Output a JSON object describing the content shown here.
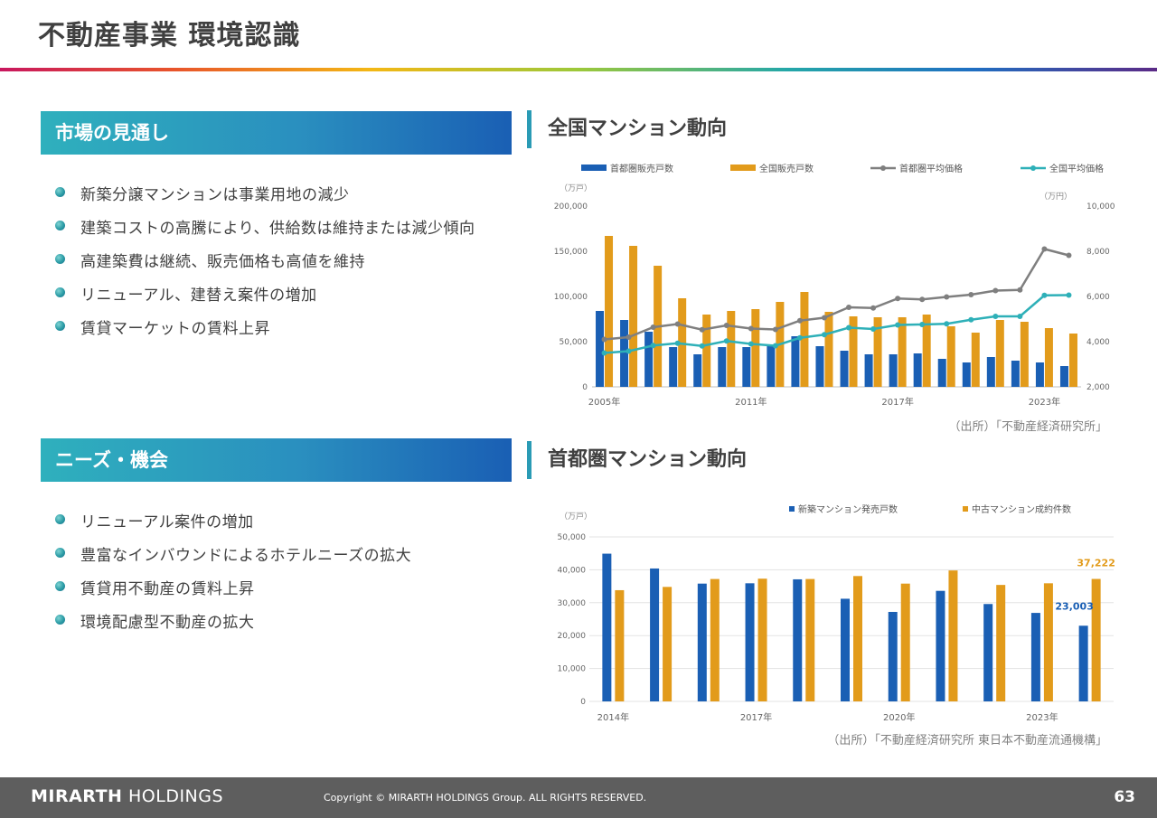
{
  "page": {
    "title": "不動産事業 環境認識",
    "page_number": "63"
  },
  "market": {
    "heading": "市場の見通し",
    "bullets": [
      "新築分譲マンションは事業用地の減少",
      "建築コストの高騰により、供給数は維持または減少傾向",
      "高建築費は継続、販売価格も高値を維持",
      "リニューアル、建替え案件の増加",
      "賃貸マーケットの賃料上昇"
    ]
  },
  "needs": {
    "heading": "ニーズ・機会",
    "bullets": [
      "リニューアル案件の増加",
      "豊富なインバウンドによるホテルニーズの拡大",
      "賃貸用不動産の賃料上昇",
      "環境配慮型不動産の拡大"
    ]
  },
  "footer": {
    "logo_bold": "MIRARTH",
    "logo_rest": "HOLDINGS",
    "copyright": "Copyright © MIRARTH HOLDINGS Group. ALL RIGHTS RESERVED."
  },
  "colors": {
    "blue": "#1a5fb4",
    "gold": "#e29b1b",
    "gray_line": "#7f7f7f",
    "teal_line": "#2eb0b8"
  },
  "chart_data": [
    {
      "type": "bar",
      "title": "全国マンション動向",
      "source": "（出所）「不動産経済研究所」",
      "y_unit": "（万戸）",
      "y2_unit": "（万円）",
      "ylim": [
        0,
        200000
      ],
      "y2lim": [
        2000,
        10000
      ],
      "y_ticks": [
        "200,000",
        "150,000",
        "100,000",
        "50,000",
        "0"
      ],
      "y2_ticks": [
        "10,000",
        "8,000",
        "6,000",
        "4,000",
        "2,000"
      ],
      "x_tick_labels": [
        {
          "index": 0,
          "label": "2005年"
        },
        {
          "index": 6,
          "label": "2011年"
        },
        {
          "index": 12,
          "label": "2017年"
        },
        {
          "index": 18,
          "label": "2023年"
        }
      ],
      "legend_position": "top",
      "categories": [
        "2005",
        "2006",
        "2007",
        "2008",
        "2009",
        "2010",
        "2011",
        "2012",
        "2013",
        "2014",
        "2015",
        "2016",
        "2017",
        "2018",
        "2019",
        "2020",
        "2021",
        "2022",
        "2023",
        "2024"
      ],
      "series": [
        {
          "name": "首都圏販売戸数",
          "kind": "bar",
          "axis": "left",
          "values": [
            84000,
            74000,
            61000,
            44000,
            36000,
            44000,
            44000,
            45000,
            56000,
            45000,
            40000,
            36000,
            36000,
            37000,
            31000,
            27000,
            33000,
            29000,
            27000,
            23000
          ]
        },
        {
          "name": "全国販売戸数",
          "kind": "bar",
          "axis": "left",
          "values": [
            167000,
            156000,
            134000,
            98000,
            80000,
            84000,
            86000,
            94000,
            105000,
            83000,
            78000,
            77000,
            77000,
            80000,
            67000,
            60000,
            74000,
            72000,
            65000,
            59000
          ]
        },
        {
          "name": "首都圏平均価格",
          "kind": "line",
          "axis": "right",
          "values": [
            4100,
            4200,
            4640,
            4780,
            4530,
            4720,
            4580,
            4540,
            4930,
            5060,
            5520,
            5490,
            5910,
            5870,
            5980,
            6080,
            6260,
            6290,
            8100,
            7820
          ]
        },
        {
          "name": "全国平均価格",
          "kind": "line",
          "axis": "right",
          "values": [
            3500,
            3580,
            3830,
            3930,
            3810,
            4030,
            3900,
            3820,
            4170,
            4310,
            4620,
            4560,
            4740,
            4760,
            4790,
            4970,
            5120,
            5120,
            6050,
            6060
          ]
        }
      ]
    },
    {
      "type": "bar",
      "title": "首都圏マンション動向",
      "source": "（出所）「不動産経済研究所 東日本不動産流通機構」",
      "y_unit": "（万戸）",
      "ylim": [
        0,
        50000
      ],
      "y_ticks": [
        "50,000",
        "40,000",
        "30,000",
        "20,000",
        "10,000",
        "0"
      ],
      "x_tick_labels": [
        {
          "index": 0,
          "label": "2014年"
        },
        {
          "index": 3,
          "label": "2017年"
        },
        {
          "index": 6,
          "label": "2020年"
        },
        {
          "index": 9,
          "label": "2023年"
        }
      ],
      "legend_position": "top",
      "categories": [
        "2014",
        "2015",
        "2016",
        "2017",
        "2018",
        "2019",
        "2020",
        "2021",
        "2022",
        "2023",
        "2024"
      ],
      "series": [
        {
          "name": "新築マンション発売戸数",
          "values": [
            44900,
            40400,
            35800,
            35900,
            37100,
            31200,
            27200,
            33600,
            29600,
            26900,
            23003
          ]
        },
        {
          "name": "中古マンション成約件数",
          "values": [
            33800,
            34800,
            37200,
            37300,
            37200,
            38100,
            35800,
            39800,
            35400,
            35900,
            37222
          ]
        }
      ],
      "annotations": [
        {
          "series": 1,
          "index": 10,
          "text": "37,222"
        },
        {
          "series": 0,
          "index": 10,
          "text": "23,003"
        }
      ]
    }
  ]
}
